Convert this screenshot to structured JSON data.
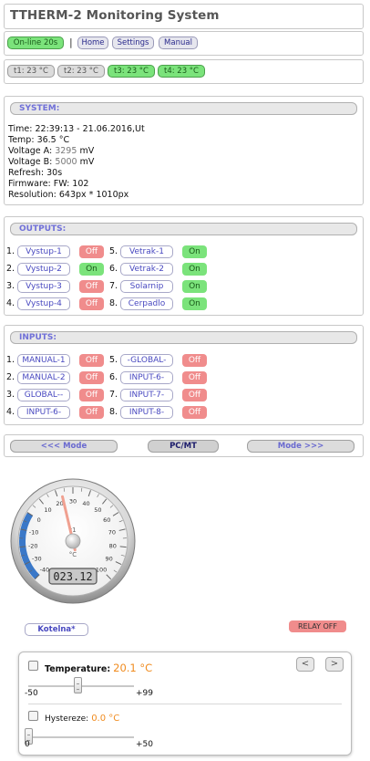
{
  "app_title": "TTHERM-2 Monitoring System",
  "nav": {
    "status": "On-line 20s",
    "separator": "|",
    "home": "Home",
    "settings": "Settings",
    "manual": "Manual"
  },
  "temps": [
    {
      "label": "t1: 23 °C",
      "active": false
    },
    {
      "label": "t2: 23 °C",
      "active": false
    },
    {
      "label": "t3: 23 °C",
      "active": true
    },
    {
      "label": "t4: 23 °C",
      "active": true
    }
  ],
  "system": {
    "header": "SYSTEM:",
    "time_label": "Time:",
    "time_value": "22:39:13 - 21.06.2016,Ut",
    "temp_label": "Temp:",
    "temp_value": "36.5 °C",
    "va_label": "Voltage A:",
    "va_value": "3295",
    "va_unit": "mV",
    "vb_label": "Voltage B:",
    "vb_value": "5000",
    "vb_unit": "mV",
    "refresh_label": "Refresh:",
    "refresh_value": "30s",
    "fw_label": "Firmware:",
    "fw_value": "FW: 102",
    "res_label": "Resolution:",
    "res_value": "643px * 1010px"
  },
  "outputs": {
    "header": "OUTPUTS:",
    "items": [
      {
        "num": "1.",
        "name": "Vystup-1",
        "state": "Off"
      },
      {
        "num": "2.",
        "name": "Vystup-2",
        "state": "On"
      },
      {
        "num": "3.",
        "name": "Vystup-3",
        "state": "Off"
      },
      {
        "num": "4.",
        "name": "Vystup-4",
        "state": "Off"
      },
      {
        "num": "5.",
        "name": "Vetrak-1",
        "state": "On"
      },
      {
        "num": "6.",
        "name": "Vetrak-2",
        "state": "On"
      },
      {
        "num": "7.",
        "name": "Solarnip",
        "state": "On"
      },
      {
        "num": "8.",
        "name": "Cerpadlo",
        "state": "On"
      }
    ]
  },
  "inputs": {
    "header": "INPUTS:",
    "items": [
      {
        "num": "1.",
        "name": "MANUAL-1",
        "state": "Off"
      },
      {
        "num": "2.",
        "name": "MANUAL-2",
        "state": "Off"
      },
      {
        "num": "3.",
        "name": "GLOBAL--",
        "state": "Off"
      },
      {
        "num": "4.",
        "name": "INPUT-6-",
        "state": "Off"
      },
      {
        "num": "5.",
        "name": "-GLOBAL-",
        "state": "Off"
      },
      {
        "num": "6.",
        "name": "INPUT-6-",
        "state": "Off"
      },
      {
        "num": "7.",
        "name": "INPUT-7-",
        "state": "Off"
      },
      {
        "num": "8.",
        "name": "INPUT-8-",
        "state": "Off"
      }
    ]
  },
  "mode": {
    "prev": "<<< Mode",
    "current": "PC/MT",
    "next": "Mode >>>"
  },
  "gauge": {
    "display": "023.12",
    "value": 23.12,
    "min": -40,
    "max": 100,
    "ticks": [
      "-40",
      "-30",
      "-20",
      "-10",
      "0",
      "10",
      "20",
      "30",
      "40",
      "50",
      "60",
      "70",
      "80",
      "90",
      "100"
    ],
    "center_label": "t1",
    "unit_label": "°C"
  },
  "kotelna": "Kotelna*",
  "relay": "RELAY OFF",
  "controls": {
    "temperature_label": "Temperature:",
    "temperature_value": "20.1 °C",
    "temp_min": "-50",
    "temp_max": "+99",
    "temp_level": 20.1,
    "prev_btn": "<",
    "next_btn": ">",
    "hysteresis_label": "Hystereze:",
    "hysteresis_value": "0.0 °C",
    "hyst_min": "0",
    "hyst_max": "+50",
    "hyst_level": 0.0
  }
}
